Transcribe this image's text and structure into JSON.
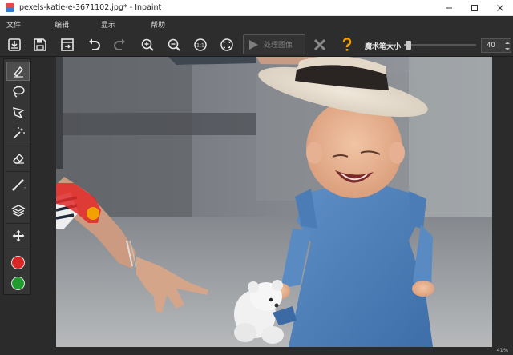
{
  "window": {
    "title": "pexels-katie-e-3671102.jpg* - Inpaint"
  },
  "menu": {
    "items": [
      "文件",
      "编辑",
      "显示",
      "帮助"
    ]
  },
  "toolbar": {
    "buttons": [
      {
        "name": "open",
        "icon": "open-file-icon"
      },
      {
        "name": "save",
        "icon": "save-icon"
      },
      {
        "name": "save-as",
        "icon": "save-as-icon"
      },
      {
        "name": "undo",
        "icon": "undo-icon"
      },
      {
        "name": "redo",
        "icon": "redo-icon"
      },
      {
        "name": "zoom-in",
        "icon": "zoom-in-icon"
      },
      {
        "name": "zoom-out",
        "icon": "zoom-out-icon"
      },
      {
        "name": "actual-size",
        "icon": "actual-size-icon",
        "label": "1:1"
      },
      {
        "name": "fit-window",
        "icon": "fit-window-icon"
      }
    ],
    "process_label": "处理图像",
    "cancel_icon": "close-x-icon",
    "help_icon": "question-icon",
    "wand_size_label": "魔术笔大小",
    "wand_size_value": "40",
    "wand_size_fraction": 0.05
  },
  "tools": {
    "items": [
      {
        "name": "marker",
        "icon": "marker-icon",
        "active": true
      },
      {
        "name": "lasso",
        "icon": "lasso-icon"
      },
      {
        "name": "polygonal-lasso",
        "icon": "polygon-lasso-icon"
      },
      {
        "name": "magic-wand",
        "icon": "magic-wand-icon"
      },
      {
        "name": "eraser",
        "icon": "eraser-icon"
      },
      {
        "name": "guide-lines",
        "icon": "line-icon"
      },
      {
        "name": "layers",
        "icon": "layers-icon"
      },
      {
        "name": "move",
        "icon": "move-icon"
      }
    ],
    "colors": {
      "remove": "#d92626",
      "keep": "#1f9e2f"
    }
  },
  "status": {
    "zoom": "41%"
  },
  "colors": {
    "accent": "#f2a200",
    "selection": "#e02a2a",
    "titlebar_bg": "#ffffff",
    "panel_bg": "#2d2d2d"
  }
}
